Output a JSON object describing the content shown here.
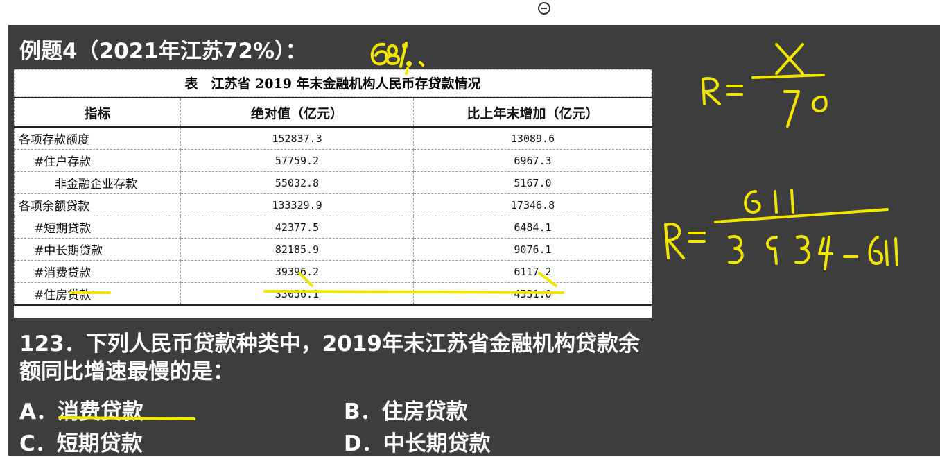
{
  "example": {
    "title": "例题4（2021年江苏72%）："
  },
  "table": {
    "caption": "表　江苏省 2019 年末金融机构人民币存贷款情况",
    "headers": [
      "指标",
      "绝对值（亿元）",
      "比上年末增加（亿元）"
    ],
    "rows": [
      {
        "label": "各项存款额度",
        "value": "152837.3",
        "increase": "13089.6",
        "level": 0
      },
      {
        "label": "#住户存款",
        "value": "57759.2",
        "increase": "6967.3",
        "level": 1
      },
      {
        "label": "非金融企业存款",
        "value": "55032.8",
        "increase": "5167.0",
        "level": 2
      },
      {
        "label": "各项余额贷款",
        "value": "133329.9",
        "increase": "17346.8",
        "level": 0
      },
      {
        "label": "#短期贷款",
        "value": "42377.5",
        "increase": "6484.1",
        "level": 1
      },
      {
        "label": "#中长期贷款",
        "value": "82185.9",
        "increase": "9076.1",
        "level": 1
      },
      {
        "label": "#消费贷款",
        "value": "39396.2",
        "increase": "6117.2",
        "level": 1
      },
      {
        "label": "#住房贷款",
        "value": "33056.1",
        "increase": "4531.0",
        "level": 1
      }
    ]
  },
  "question": {
    "text": "123．下列人民币贷款种类中，2019年末江苏省金融机构贷款余额同比增速最慢的是：",
    "options": {
      "a": "A．消费贷款",
      "b": "B．住房贷款",
      "c": "C．短期贷款",
      "d": "D．中长期贷款"
    }
  },
  "handwriting": {
    "answer_note": "68%.",
    "formula_1": "R = X / Y0",
    "formula_2": "R = 611 / (3939 - 611)",
    "ink_color": "#f2e600"
  }
}
